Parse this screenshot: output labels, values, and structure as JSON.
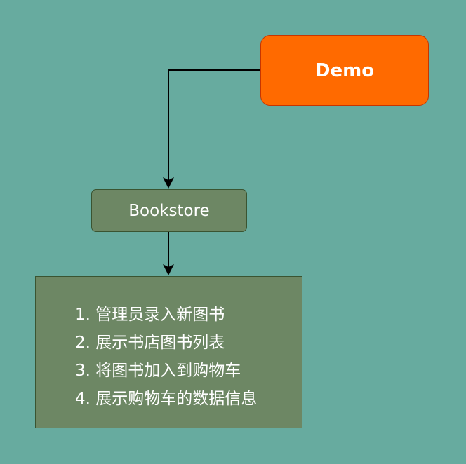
{
  "diagram": {
    "nodes": {
      "demo": {
        "label": "Demo",
        "color": "#FF6A00"
      },
      "bookstore": {
        "label": "Bookstore",
        "color": "#6D8764"
      },
      "features": {
        "color": "#6D8764",
        "items": [
          "1. 管理员录入新图书",
          "2. 展示书店图书列表",
          "3. 将图书加入到购物车",
          "4. 展示购物车的数据信息"
        ]
      }
    },
    "edges": [
      {
        "from": "demo",
        "to": "bookstore"
      },
      {
        "from": "bookstore",
        "to": "features"
      }
    ],
    "background": "#67AB9F"
  }
}
